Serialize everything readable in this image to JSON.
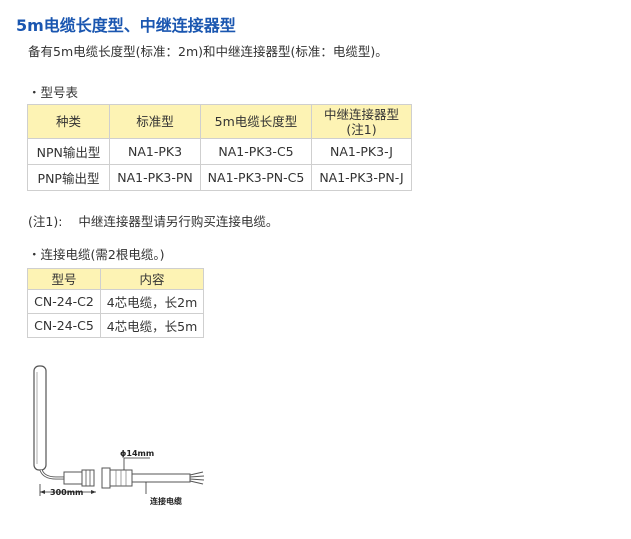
{
  "title": "5m电缆长度型、中继连接器型",
  "description": "备有5m电缆长度型(标准：2m)和中继连接器型(标准：电缆型)。",
  "model_section": {
    "label": "・型号表",
    "headers": [
      "种类",
      "标准型",
      "5m电缆长度型",
      "中继连接器型",
      "(注1)"
    ],
    "rows": [
      [
        "NPN输出型",
        "NA1-PK3",
        "NA1-PK3-C5",
        "NA1-PK3-J"
      ],
      [
        "PNP输出型",
        "NA1-PK3-PN",
        "NA1-PK3-PN-C5",
        "NA1-PK3-PN-J"
      ]
    ]
  },
  "note": {
    "label": "(注1):",
    "text": "中继连接器型请另行购买连接电缆。"
  },
  "cable_section": {
    "label": "・连接电缆(需2根电缆。)",
    "headers": [
      "型号",
      "内容"
    ],
    "rows": [
      [
        "CN-24-C2",
        "4芯电缆，长2m"
      ],
      [
        "CN-24-C5",
        "4芯电缆，长5m"
      ]
    ]
  },
  "diagram": {
    "diameter_label": "ϕ14mm",
    "length_label": "300mm",
    "cable_label": "连接电缆"
  }
}
